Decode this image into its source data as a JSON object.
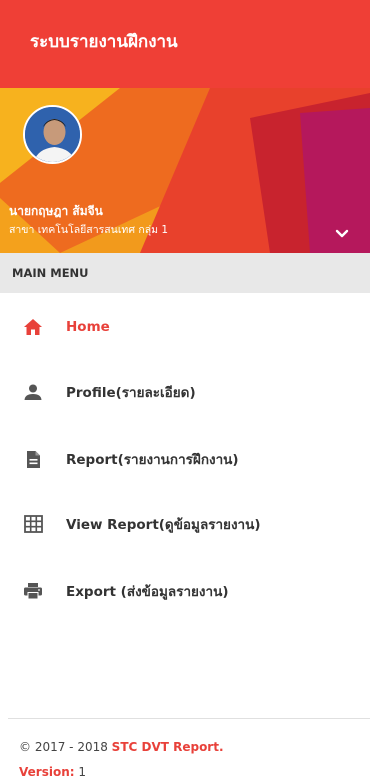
{
  "appbar": {
    "title": "ระบบรายงานฝึกงาน"
  },
  "profile": {
    "name": "นายกฤษฎา ส้มจีน",
    "department": "สาขา เทคโนโลยีสารสนเทศ กลุ่ม 1"
  },
  "menu_header": "MAIN MENU",
  "menu": {
    "items": [
      {
        "label": "Home",
        "icon": "home-icon",
        "active": true
      },
      {
        "label": "Profile(รายละเอียด)",
        "icon": "person-icon",
        "active": false
      },
      {
        "label": "Report(รายงานการฝึกงาน)",
        "icon": "document-icon",
        "active": false
      },
      {
        "label": "View Report(ดูข้อมูลรายงาน)",
        "icon": "grid-icon",
        "active": false
      },
      {
        "label": "Export (ส่งข้อมูลรายงาน)",
        "icon": "printer-icon",
        "active": false
      }
    ]
  },
  "footer": {
    "copyright_prefix": "© 2017 - 2018 ",
    "brand": "STC DVT Report.",
    "version_label": "Version:",
    "version_value": " 1"
  },
  "colors": {
    "primary": "#ef3f36",
    "accent": "#e8413a",
    "menu_header_bg": "#e8e8e8"
  }
}
